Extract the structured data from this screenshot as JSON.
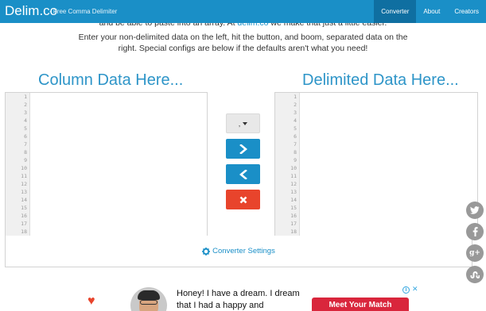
{
  "navbar": {
    "brand": "Delim.co",
    "tagline": "- Free Comma Delimiter",
    "items": [
      {
        "label": "Converter",
        "active": true
      },
      {
        "label": "About",
        "active": false
      },
      {
        "label": "Creators",
        "active": false
      }
    ],
    "color": "#1a8fc7"
  },
  "intro": {
    "line1_prefix": "and be able to paste into an array. At ",
    "line1_link": "delim.co",
    "line1_suffix": " we make that just a little easier.",
    "line2": "Enter your non-delimited data on the left, hit the button, and boom, separated data on the",
    "line3": "right. Special configs are below if the defaults aren't what you need!"
  },
  "left_panel": {
    "title": "Column Data Here...",
    "line_numbers": [
      "1",
      "2",
      "3",
      "4",
      "5",
      "6",
      "7",
      "8",
      "9",
      "10",
      "11",
      "12",
      "13",
      "14",
      "15",
      "16",
      "17",
      "18"
    ]
  },
  "right_panel": {
    "title": "Delimited Data Here...",
    "line_numbers": [
      "1",
      "2",
      "3",
      "4",
      "5",
      "6",
      "7",
      "8",
      "9",
      "10",
      "11",
      "12",
      "13",
      "14",
      "15",
      "16",
      "17",
      "18"
    ]
  },
  "controls": {
    "delimiter_value": ",",
    "convert_right_icon": "chevron-right-icon",
    "convert_left_icon": "chevron-left-icon",
    "clear_icon": "close-icon"
  },
  "settings": {
    "label": "Converter Settings",
    "icon": "gear-icon"
  },
  "social": [
    "twitter-icon",
    "facebook-icon",
    "google-plus-icon",
    "stumbleupon-icon"
  ],
  "ad": {
    "text": "Honey! I have a dream. I dream that I had a happy and",
    "button_label": "Meet Your Match",
    "choices_icon": "ad-choices-icon",
    "close_label": "✕"
  },
  "colors": {
    "accent": "#1a8fc7",
    "title": "#2e95c8",
    "danger": "#e8442c",
    "social": "#999999"
  }
}
